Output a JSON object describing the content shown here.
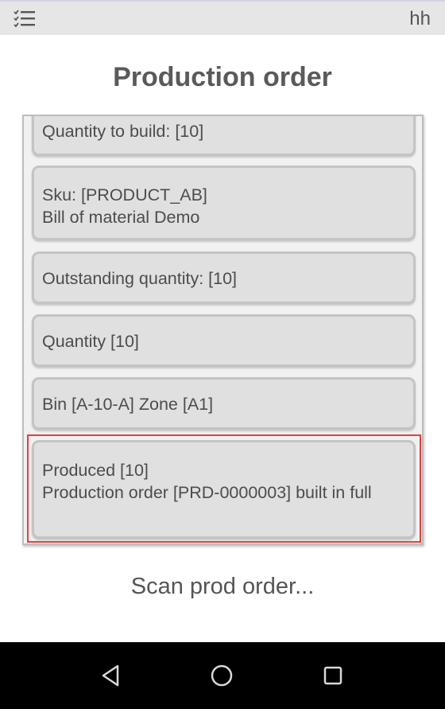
{
  "topbar": {
    "menu_icon": "checklist-menu-icon",
    "user": "hh"
  },
  "page": {
    "title": "Production order"
  },
  "cards": [
    {
      "lines": [
        "Quantity to build: [10]"
      ]
    },
    {
      "lines": [
        "Sku: [PRODUCT_AB]",
        "Bill of material Demo"
      ]
    },
    {
      "lines": [
        "Outstanding quantity: [10]"
      ]
    },
    {
      "lines": [
        "Quantity [10]"
      ]
    },
    {
      "lines": [
        "Bin [A-10-A] Zone [A1]"
      ]
    },
    {
      "lines": [
        "Produced [10]",
        "Production order [PRD-0000003] built in full"
      ]
    }
  ],
  "status": {
    "prompt": "Scan prod order..."
  },
  "navbar": {
    "back_icon": "back-triangle-icon",
    "home_icon": "home-circle-icon",
    "recent_icon": "recent-apps-square-icon"
  },
  "colors": {
    "highlight": "#e0413f",
    "card_background": "#e0e0e0",
    "navbar": "#000000"
  }
}
